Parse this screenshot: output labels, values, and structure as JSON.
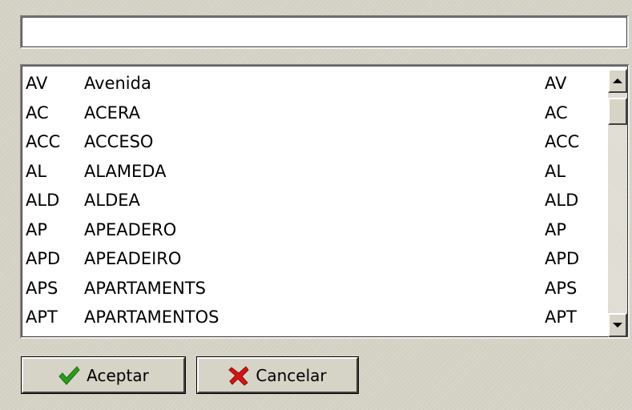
{
  "search": {
    "value": "",
    "placeholder": ""
  },
  "list": {
    "rows": [
      {
        "code": "AV",
        "name": "Avenida",
        "abbr": "AV"
      },
      {
        "code": "AC",
        "name": "ACERA",
        "abbr": "AC"
      },
      {
        "code": "ACC",
        "name": "ACCESO",
        "abbr": "ACC"
      },
      {
        "code": "AL",
        "name": "ALAMEDA",
        "abbr": "AL"
      },
      {
        "code": "ALD",
        "name": "ALDEA",
        "abbr": "ALD"
      },
      {
        "code": "AP",
        "name": "APEADERO",
        "abbr": "AP"
      },
      {
        "code": "APD",
        "name": "APEADEIRO",
        "abbr": "APD"
      },
      {
        "code": "APS",
        "name": "APARTAMENTS",
        "abbr": "APS"
      },
      {
        "code": "APT",
        "name": "APARTAMENTOS",
        "abbr": "APT"
      }
    ]
  },
  "buttons": {
    "accept": {
      "label": "Aceptar",
      "icon": "checkmark-icon",
      "icon_color": "#2e9a1e"
    },
    "cancel": {
      "label": "Cancelar",
      "icon": "x-icon",
      "icon_color": "#d41414"
    }
  },
  "scrollbar": {
    "up_icon": "arrow-up-icon",
    "down_icon": "arrow-down-icon"
  }
}
